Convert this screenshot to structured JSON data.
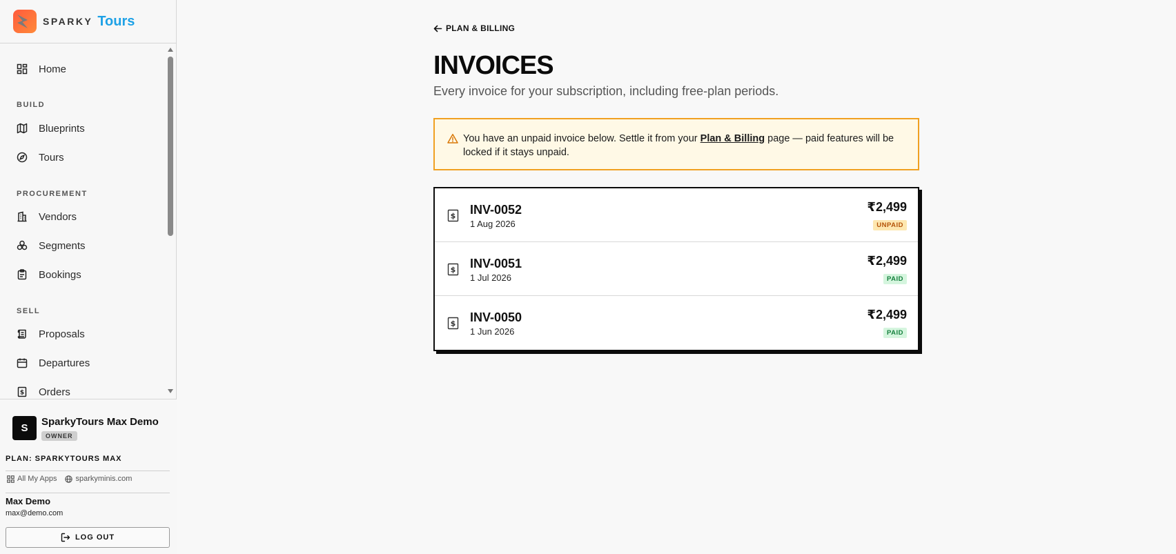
{
  "brand": {
    "name": "SPARKY",
    "accent": "Tours"
  },
  "nav": {
    "home": "Home",
    "sections": {
      "build": "BUILD",
      "procurement": "PROCUREMENT",
      "sell": "SELL"
    },
    "items": {
      "blueprints": "Blueprints",
      "tours": "Tours",
      "vendors": "Vendors",
      "segments": "Segments",
      "bookings": "Bookings",
      "proposals": "Proposals",
      "departures": "Departures",
      "orders": "Orders"
    }
  },
  "footer": {
    "org_initial": "S",
    "org_name": "SparkyTours Max Demo",
    "org_role": "OWNER",
    "plan": "PLAN: SPARKYTOURS MAX",
    "link_apps": "All My Apps",
    "link_site": "sparkyminis.com",
    "user_name": "Max Demo",
    "user_email": "max@demo.com",
    "logout": "LOG OUT"
  },
  "main": {
    "back": "PLAN & BILLING",
    "title": "INVOICES",
    "subtitle": "Every invoice for your subscription, including free-plan periods.",
    "alert": {
      "before": "You have an unpaid invoice below. Settle it from your ",
      "link": "Plan & Billing",
      "after": " page — paid features will be locked if it stays unpaid."
    },
    "invoices": [
      {
        "id": "INV-0052",
        "date": "1 Aug 2026",
        "amount": "₹2,499",
        "status": "UNPAID",
        "status_bg": "#fde7b0",
        "status_fg": "#b45309"
      },
      {
        "id": "INV-0051",
        "date": "1 Jul 2026",
        "amount": "₹2,499",
        "status": "PAID",
        "status_bg": "#d5f5de",
        "status_fg": "#15803d"
      },
      {
        "id": "INV-0050",
        "date": "1 Jun 2026",
        "amount": "₹2,499",
        "status": "PAID",
        "status_bg": "#d5f5de",
        "status_fg": "#15803d"
      }
    ]
  },
  "colors": {
    "accent": "#1ea1e6",
    "alert_border": "#f0a020",
    "alert_bg": "#fff9e6"
  }
}
